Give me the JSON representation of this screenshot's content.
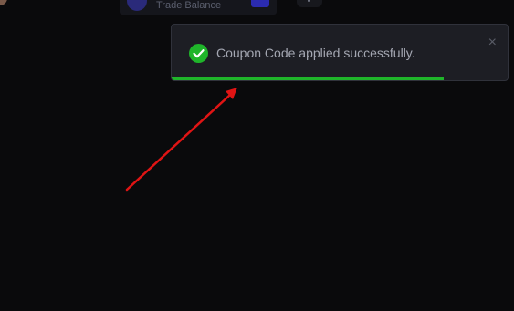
{
  "header": {
    "balance_label": "Trade Balance"
  },
  "toast": {
    "message": "Coupon Code applied successfully.",
    "close_glyph": "×",
    "status": "success",
    "progress_remaining": 0.81,
    "accent_color": "#1fb52a"
  },
  "annotation": {
    "arrow_color": "#e01414"
  },
  "icons": {
    "toast_icon": "check-circle-icon",
    "close_icon": "close-icon",
    "menu_icon": "more-icon"
  }
}
